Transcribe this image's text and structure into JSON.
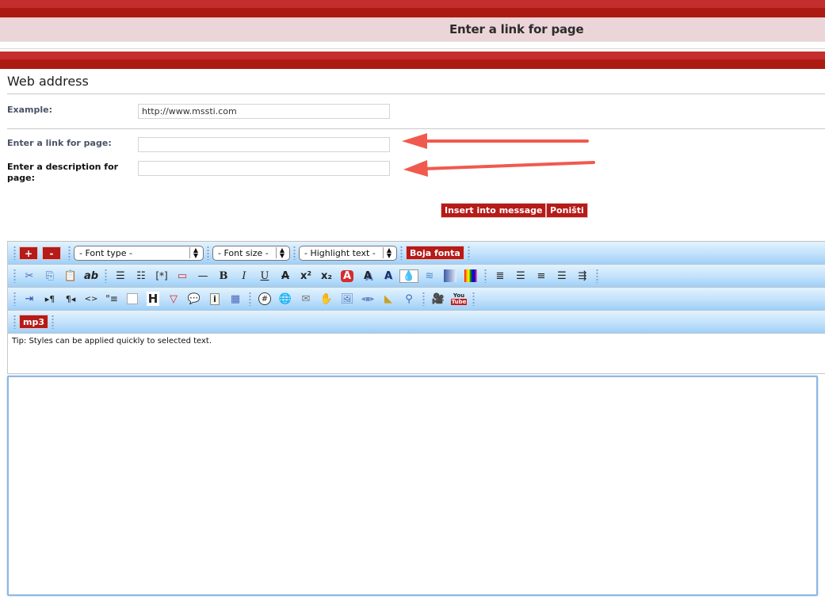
{
  "header": {
    "title": "Enter a link for page"
  },
  "section": {
    "title": "Web address"
  },
  "form": {
    "example_label": "Example:",
    "example_value": "http://www.mssti.com",
    "link_label": "Enter a link for page:",
    "link_value": "",
    "description_label": "Enter a description for page:",
    "description_value": "",
    "insert_button": "Insert into message",
    "cancel_button": "Poništi"
  },
  "toolbar": {
    "row1": {
      "increase_label": "+",
      "decrease_label": "-",
      "font_type": "- Font type -",
      "font_size": "- Font size -",
      "highlight_text": "- Highlight text -",
      "font_color": "Boja fonta"
    },
    "row2_icons": [
      "cut-icon",
      "copy-icon",
      "paste-icon",
      "plain-text-icon",
      "bullet-list-icon",
      "numbered-list-icon",
      "list-item-icon",
      "spoiler-icon",
      "horizontal-rule-icon",
      "bold-icon",
      "italic-icon",
      "underline-icon",
      "strikethrough-icon",
      "superscript-icon",
      "subscript-icon",
      "font-color-icon",
      "glow-icon",
      "shadow-icon",
      "drop-shadow-icon",
      "wave-icon",
      "gradient-icon",
      "rainbow-icon",
      "justify-icon",
      "align-left-icon",
      "align-center-icon",
      "align-right-icon",
      "indent-icon"
    ],
    "row3_icons": [
      "move-icon",
      "ltr-icon",
      "rtl-icon",
      "code-icon",
      "quote-icon",
      "blank-icon",
      "heading-icon",
      "warning-icon",
      "speech-bubble-icon",
      "info-icon",
      "table-icon",
      "hash-icon",
      "url-icon",
      "email-icon",
      "hand-icon",
      "image-icon",
      "flash-icon",
      "hat-icon",
      "search-icon",
      "video-icon",
      "youtube-icon"
    ],
    "row4": {
      "mp3_label": "mp3"
    },
    "youtube_top": "You",
    "youtube_bottom": "Tube"
  },
  "tip": {
    "text": "Tip: Styles can be applied quickly to selected text."
  },
  "colors": {
    "brand_red": "#b51b18",
    "header_pink": "#ecd5d8",
    "toolbar_blue": "#c5e3fb",
    "arrow": "#f05a4e"
  }
}
